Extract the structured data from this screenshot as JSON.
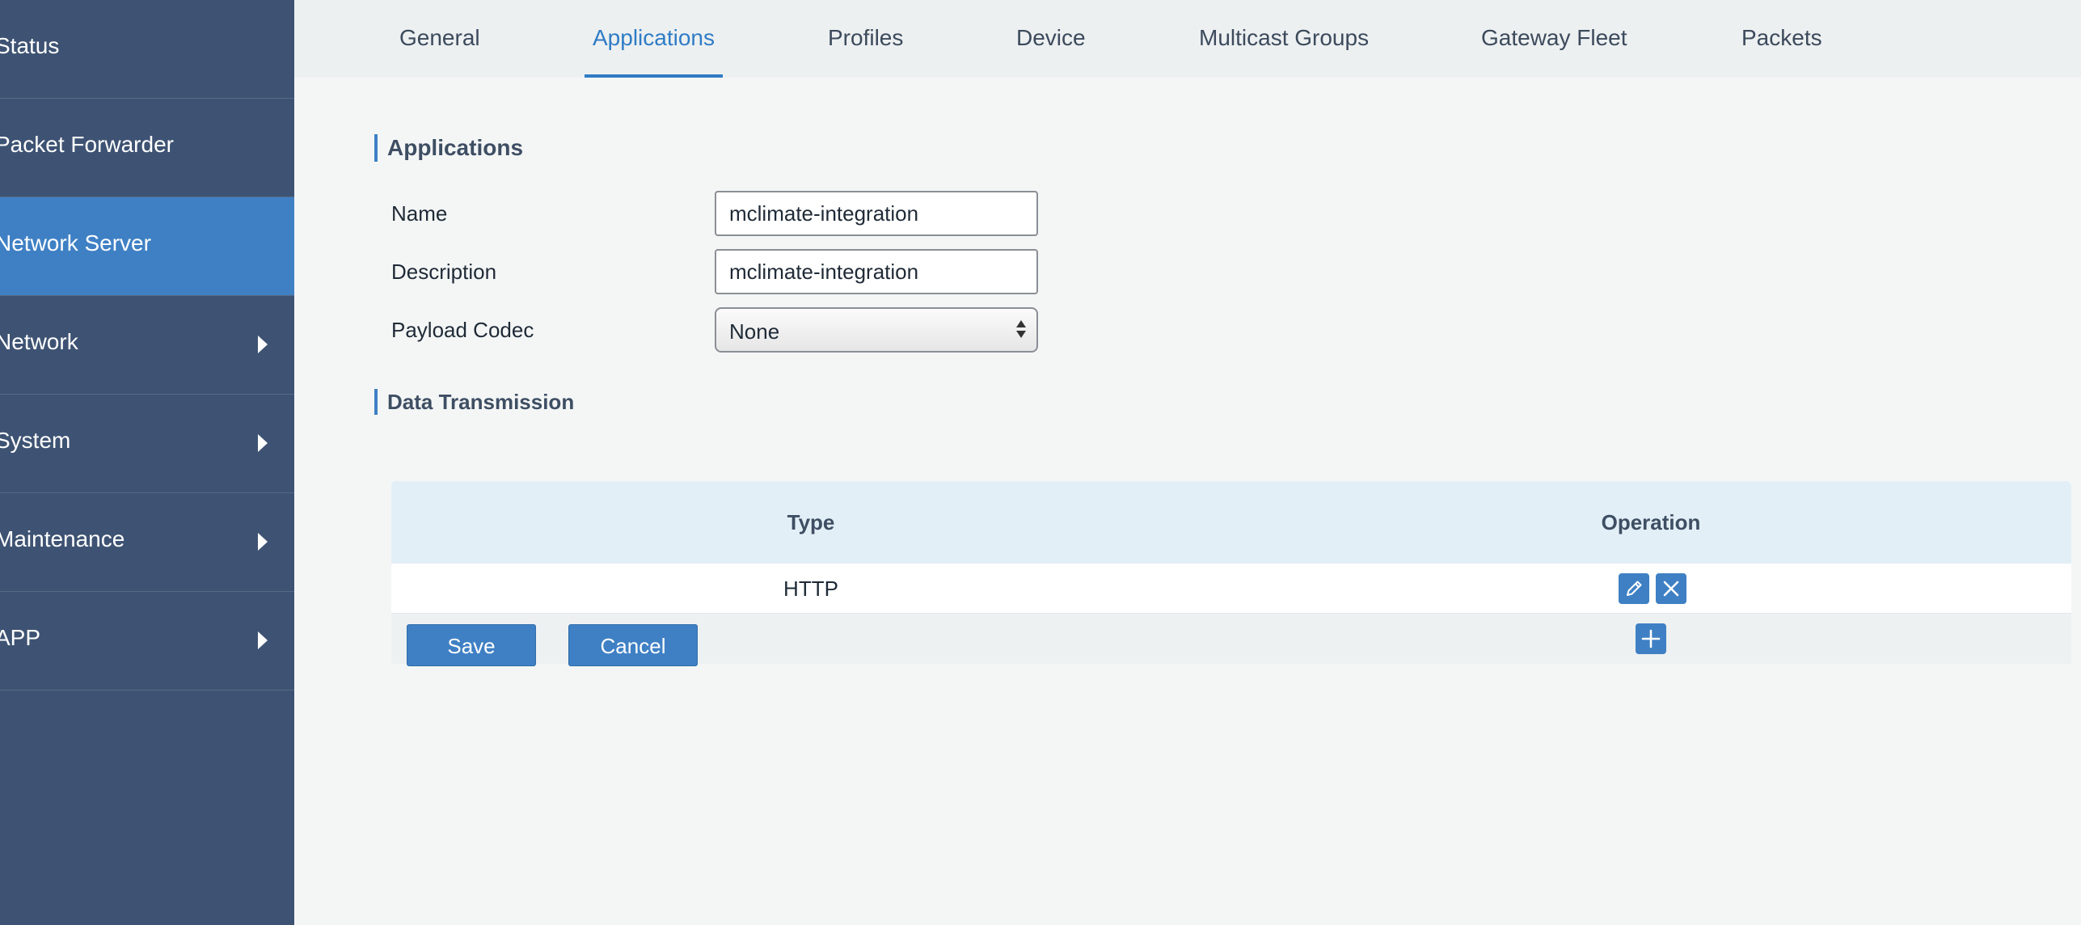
{
  "sidebar": {
    "items": [
      {
        "label": "Status"
      },
      {
        "label": "Packet Forwarder"
      },
      {
        "label": "Network Server",
        "active": true
      },
      {
        "label": "Network"
      },
      {
        "label": "System"
      },
      {
        "label": "Maintenance"
      },
      {
        "label": "APP"
      }
    ]
  },
  "tabs": [
    {
      "label": "General"
    },
    {
      "label": "Applications",
      "active": true
    },
    {
      "label": "Profiles"
    },
    {
      "label": "Device"
    },
    {
      "label": "Multicast Groups"
    },
    {
      "label": "Gateway Fleet"
    },
    {
      "label": "Packets"
    }
  ],
  "applications": {
    "section_title": "Applications",
    "name_label": "Name",
    "name_value": "mclimate-integration",
    "description_label": "Description",
    "description_value": "mclimate-integration",
    "codec_label": "Payload Codec",
    "codec_value": "None"
  },
  "data_transmission": {
    "section_title": "Data Transmission",
    "columns": [
      "Type",
      "Operation"
    ],
    "rows": [
      {
        "type": "HTTP"
      }
    ]
  },
  "actions": {
    "save_label": "Save",
    "cancel_label": "Cancel"
  },
  "icons": {
    "edit": "pencil-icon",
    "delete": "close-icon",
    "add": "plus-icon",
    "expand": "chevron-right-icon"
  },
  "colors": {
    "sidebar_bg": "#3e5373",
    "sidebar_active": "#3f80c4",
    "accent": "#2f7cc5",
    "button": "#3f80c4",
    "table_header": "#e3eff7"
  }
}
